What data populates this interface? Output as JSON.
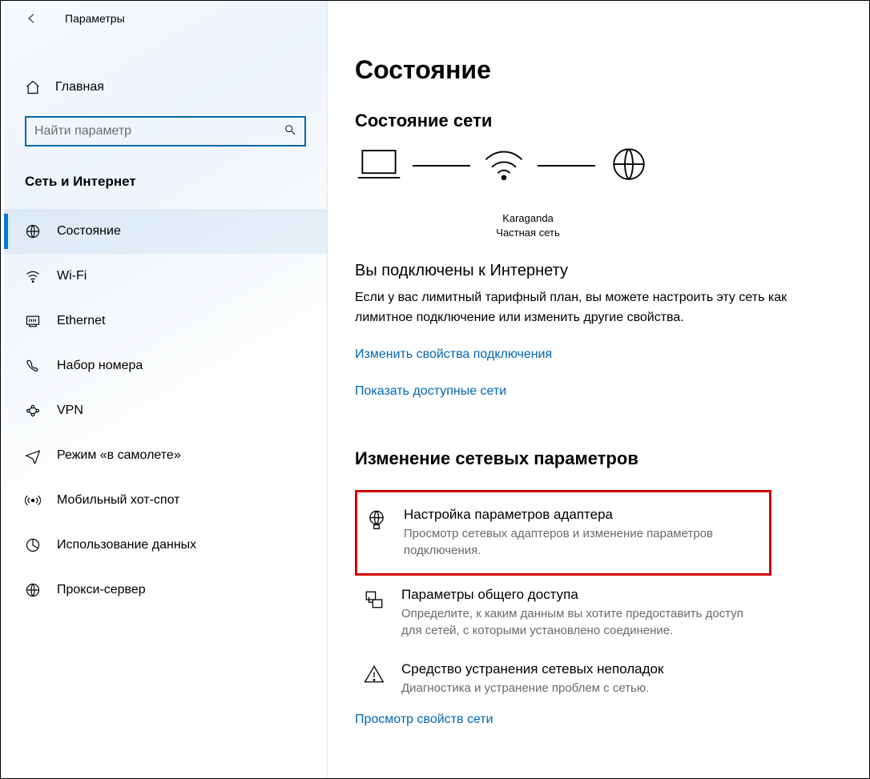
{
  "app_title": "Параметры",
  "home_label": "Главная",
  "search_placeholder": "Найти параметр",
  "category_label": "Сеть и Интернет",
  "nav": [
    {
      "id": "status",
      "label": "Состояние",
      "active": true
    },
    {
      "id": "wifi",
      "label": "Wi-Fi"
    },
    {
      "id": "ethernet",
      "label": "Ethernet"
    },
    {
      "id": "dialup",
      "label": "Набор номера"
    },
    {
      "id": "vpn",
      "label": "VPN"
    },
    {
      "id": "airplane",
      "label": "Режим «в самолете»"
    },
    {
      "id": "hotspot",
      "label": "Мобильный хот-спот"
    },
    {
      "id": "datausage",
      "label": "Использование данных"
    },
    {
      "id": "proxy",
      "label": "Прокси-сервер"
    }
  ],
  "page_title": "Состояние",
  "network_status_title": "Состояние сети",
  "diagram": {
    "ssid": "Karaganda",
    "network_type": "Частная сеть"
  },
  "connected_heading": "Вы подключены к Интернету",
  "connected_desc": "Если у вас лимитный тарифный план, вы можете настроить эту сеть как лимитное подключение или изменить другие свойства.",
  "link_change_props": "Изменить свойства подключения",
  "link_show_networks": "Показать доступные сети",
  "change_section_title": "Изменение сетевых параметров",
  "options": [
    {
      "id": "adapter",
      "title": "Настройка параметров адаптера",
      "desc": "Просмотр сетевых адаптеров и изменение параметров подключения.",
      "highlight": true
    },
    {
      "id": "sharing",
      "title": "Параметры общего доступа",
      "desc": "Определите, к каким данным вы хотите предоставить доступ для сетей, с которыми установлено соединение."
    },
    {
      "id": "troubleshoot",
      "title": "Средство устранения сетевых неполадок",
      "desc": "Диагностика и устранение проблем с сетью."
    }
  ],
  "link_network_props": "Просмотр свойств сети"
}
